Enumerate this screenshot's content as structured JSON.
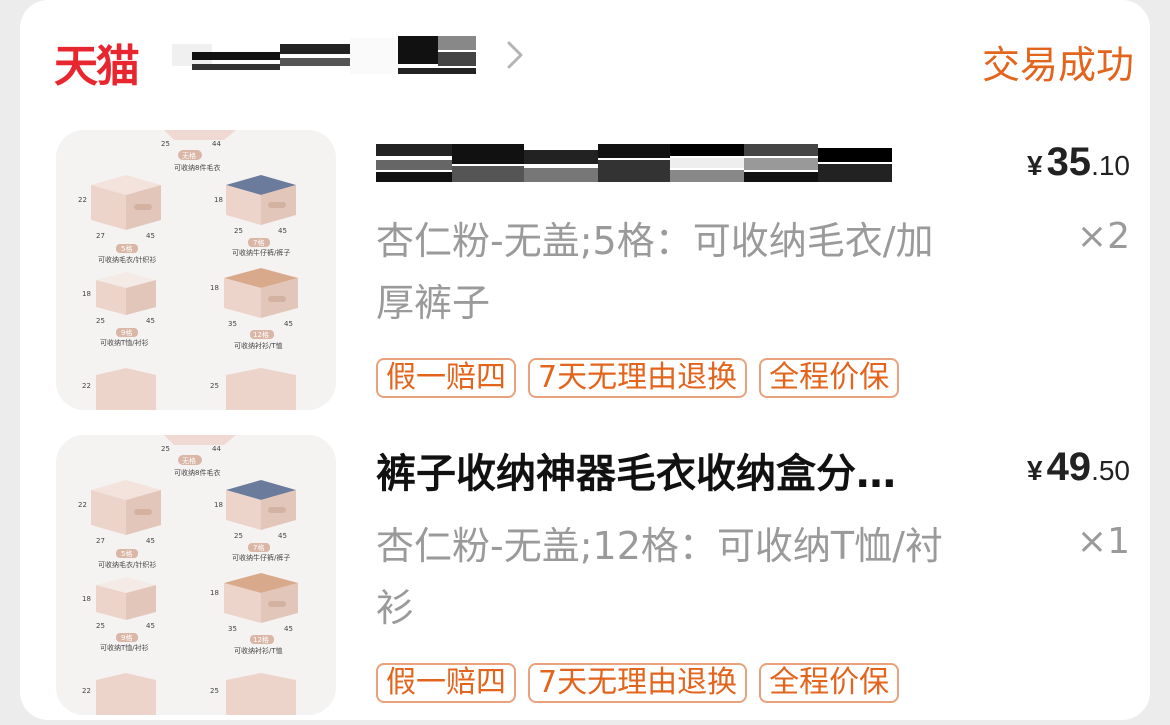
{
  "store": {
    "platform_logo": "天猫",
    "status": "交易成功",
    "chevron": "chevron-right-icon"
  },
  "products": [
    {
      "title": "",
      "price_symbol": "¥",
      "price_int": "35",
      "price_dec": ".10",
      "spec": "杏仁粉-无盖;5格：可收纳毛衣/加厚裤子",
      "quantity": "×2",
      "tags": [
        "假一赔四",
        "7天无理由退换",
        "全程价保"
      ]
    },
    {
      "title": "裤子收纳神器毛衣收纳盒分…",
      "price_symbol": "¥",
      "price_int": "49",
      "price_dec": ".50",
      "spec": "杏仁粉-无盖;12格：可收纳T恤/衬衫",
      "quantity": "×1",
      "tags": [
        "假一赔四",
        "7天无理由退换",
        "全程价保"
      ]
    }
  ],
  "thumbnail": {
    "labels_top": [
      "25",
      "44",
      "无格",
      "可收纳8件毛衣"
    ],
    "box_5": {
      "dims": [
        "22",
        "27",
        "45"
      ],
      "name": "5格",
      "desc": "可收纳毛衣/针织衫"
    },
    "box_7": {
      "dims": [
        "18",
        "25",
        "45"
      ],
      "name": "7格",
      "desc": "可收纳牛仔裤/裤子"
    },
    "box_9": {
      "dims": [
        "18",
        "25",
        "45"
      ],
      "name": "9格",
      "desc": "可收纳T恤/衬衫"
    },
    "box_12": {
      "dims": [
        "18",
        "35",
        "45"
      ],
      "name": "12格",
      "desc": "可收纳衬衫/T恤"
    },
    "bottom_dims": [
      "22",
      "25"
    ]
  },
  "colors": {
    "tmall_red": "#e8262f",
    "status_orange": "#e3641d",
    "tag_border": "#e9a27d",
    "box_pink": "#efd9d2"
  }
}
